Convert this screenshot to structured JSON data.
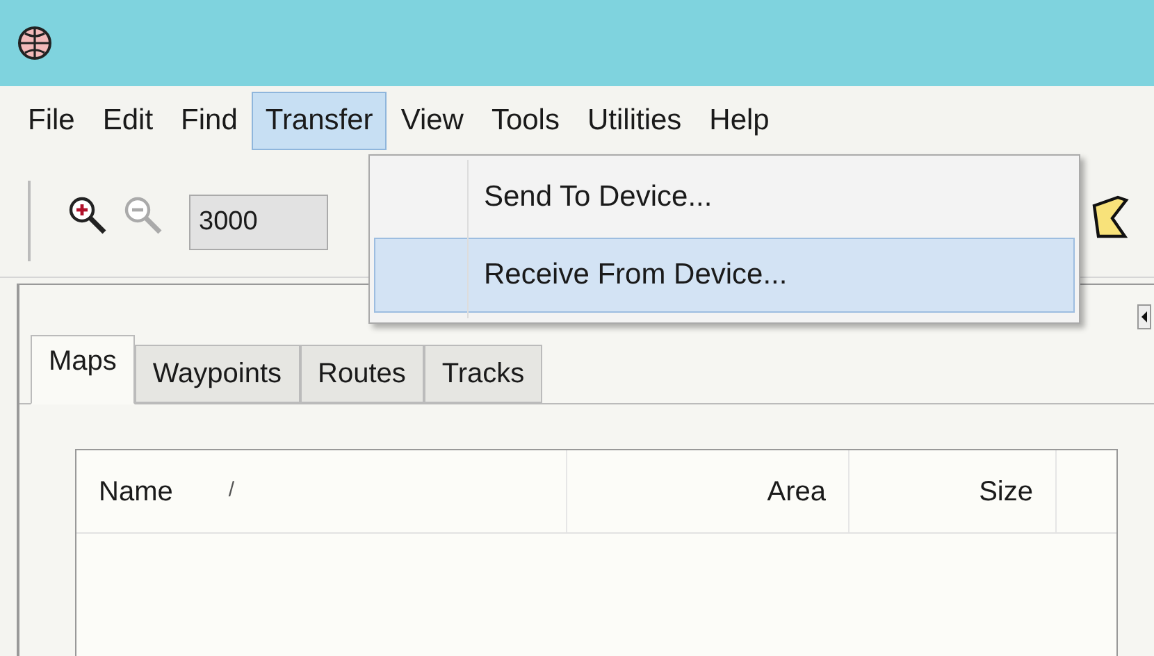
{
  "menu_bar": [
    {
      "label": "File",
      "selected": false
    },
    {
      "label": "Edit",
      "selected": false
    },
    {
      "label": "Find",
      "selected": false
    },
    {
      "label": "Transfer",
      "selected": true
    },
    {
      "label": "View",
      "selected": false
    },
    {
      "label": "Tools",
      "selected": false
    },
    {
      "label": "Utilities",
      "selected": false
    },
    {
      "label": "Help",
      "selected": false
    }
  ],
  "toolbar": {
    "scale_field": "3000"
  },
  "dropdown": [
    {
      "label": "Send To Device...",
      "selected": false
    },
    {
      "label": "Receive From Device...",
      "selected": true
    }
  ],
  "tabs": [
    {
      "label": "Maps",
      "selected": true
    },
    {
      "label": "Waypoints",
      "selected": false
    },
    {
      "label": "Routes",
      "selected": false
    },
    {
      "label": "Tracks",
      "selected": false
    }
  ],
  "table": {
    "columns": [
      {
        "label": "Name",
        "sort_mark": "/"
      },
      {
        "label": "Area"
      },
      {
        "label": "Size"
      }
    ]
  }
}
